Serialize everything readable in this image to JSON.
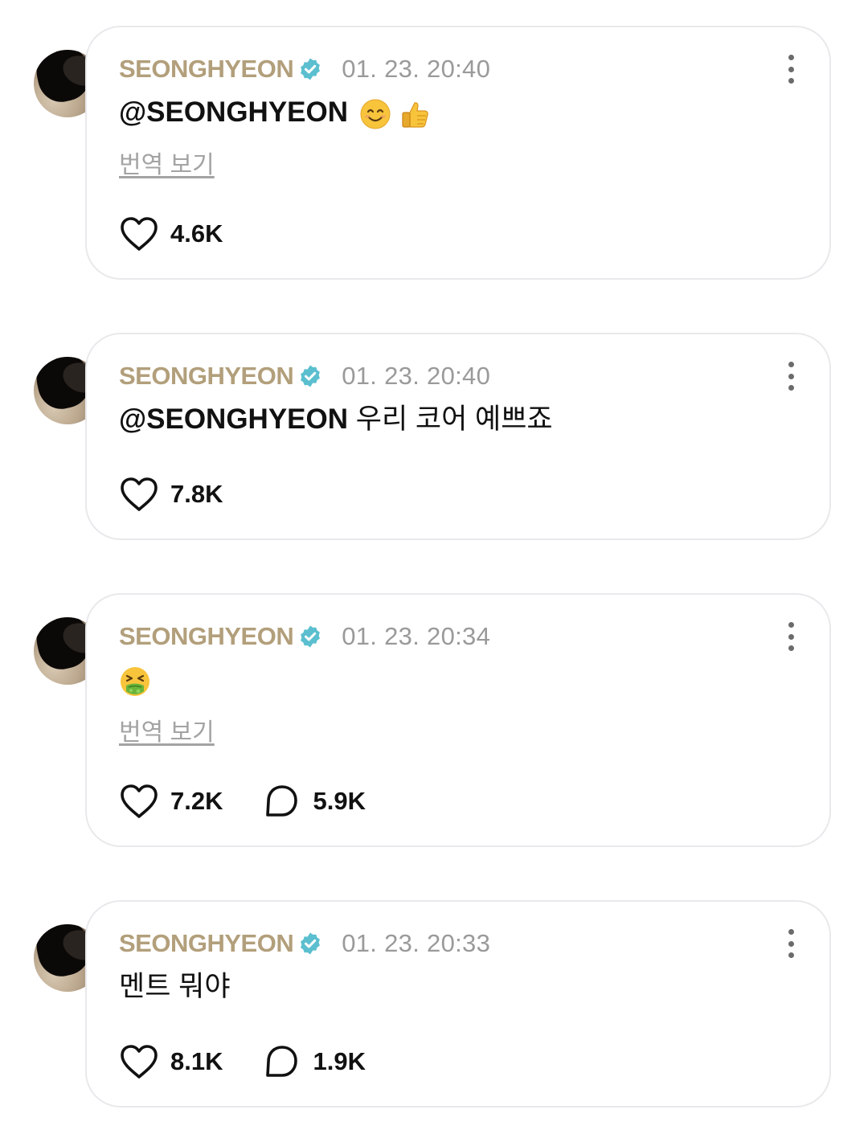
{
  "posts": [
    {
      "author": "SEONGHYEON",
      "timestamp": "01. 23. 20:40",
      "mention": "@SEONGHYEON",
      "text": "",
      "emojis": [
        "smiling-face",
        "thumbs-up"
      ],
      "translate_label": "번역 보기",
      "likes": "4.6K",
      "comments": null
    },
    {
      "author": "SEONGHYEON",
      "timestamp": "01. 23. 20:40",
      "mention": "@SEONGHYEON",
      "text": " 우리 코어 예쁘죠",
      "emojis": [],
      "translate_label": null,
      "likes": "7.8K",
      "comments": null
    },
    {
      "author": "SEONGHYEON",
      "timestamp": "01. 23. 20:34",
      "mention": "",
      "text": "",
      "emojis": [
        "nauseated-face"
      ],
      "translate_label": "번역 보기",
      "likes": "7.2K",
      "comments": "5.9K"
    },
    {
      "author": "SEONGHYEON",
      "timestamp": "01. 23. 20:33",
      "mention": "",
      "text": "멘트 뭐야",
      "emojis": [],
      "translate_label": null,
      "likes": "8.1K",
      "comments": "1.9K"
    }
  ],
  "colors": {
    "author": "#b29f7b",
    "verified": "#5bbfcf",
    "timestamp": "#9a9a9a",
    "card_border": "#e9e9ec",
    "translate": "#a3a3a3"
  }
}
